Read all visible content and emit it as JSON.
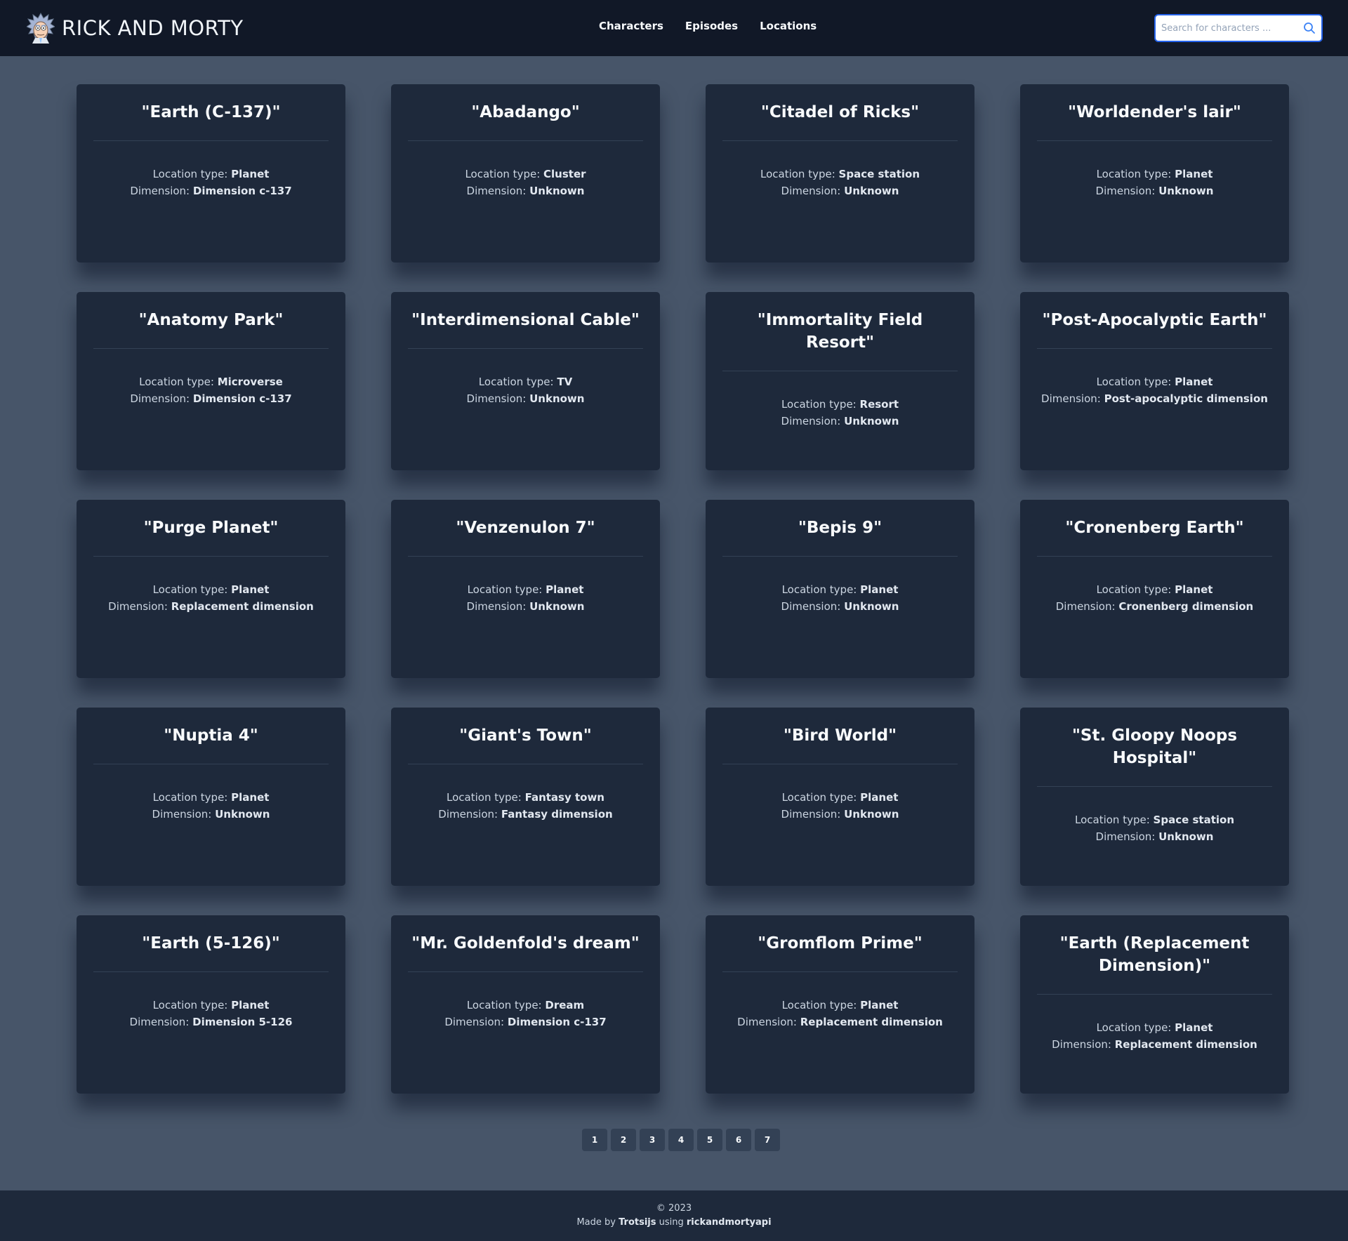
{
  "header": {
    "brand_title": "RICK AND MORTY",
    "nav": [
      "Characters",
      "Episodes",
      "Locations"
    ],
    "search_placeholder": "Search for characters ..."
  },
  "labels": {
    "location_type": "Location type:",
    "dimension": "Dimension:"
  },
  "locations": [
    {
      "name": "\"Earth (C-137)\"",
      "type": "Planet",
      "dimension": "Dimension c-137"
    },
    {
      "name": "\"Abadango\"",
      "type": "Cluster",
      "dimension": "Unknown"
    },
    {
      "name": "\"Citadel of Ricks\"",
      "type": "Space station",
      "dimension": "Unknown"
    },
    {
      "name": "\"Worldender's lair\"",
      "type": "Planet",
      "dimension": "Unknown"
    },
    {
      "name": "\"Anatomy Park\"",
      "type": "Microverse",
      "dimension": "Dimension c-137"
    },
    {
      "name": "\"Interdimensional Cable\"",
      "type": "TV",
      "dimension": "Unknown"
    },
    {
      "name": "\"Immortality Field Resort\"",
      "type": "Resort",
      "dimension": "Unknown"
    },
    {
      "name": "\"Post-Apocalyptic Earth\"",
      "type": "Planet",
      "dimension": "Post-apocalyptic dimension"
    },
    {
      "name": "\"Purge Planet\"",
      "type": "Planet",
      "dimension": "Replacement dimension"
    },
    {
      "name": "\"Venzenulon 7\"",
      "type": "Planet",
      "dimension": "Unknown"
    },
    {
      "name": "\"Bepis 9\"",
      "type": "Planet",
      "dimension": "Unknown"
    },
    {
      "name": "\"Cronenberg Earth\"",
      "type": "Planet",
      "dimension": "Cronenberg dimension"
    },
    {
      "name": "\"Nuptia 4\"",
      "type": "Planet",
      "dimension": "Unknown"
    },
    {
      "name": "\"Giant's Town\"",
      "type": "Fantasy town",
      "dimension": "Fantasy dimension"
    },
    {
      "name": "\"Bird World\"",
      "type": "Planet",
      "dimension": "Unknown"
    },
    {
      "name": "\"St. Gloopy Noops Hospital\"",
      "type": "Space station",
      "dimension": "Unknown"
    },
    {
      "name": "\"Earth (5-126)\"",
      "type": "Planet",
      "dimension": "Dimension 5-126"
    },
    {
      "name": "\"Mr. Goldenfold's dream\"",
      "type": "Dream",
      "dimension": "Dimension c-137"
    },
    {
      "name": "\"Gromflom Prime\"",
      "type": "Planet",
      "dimension": "Replacement dimension"
    },
    {
      "name": "\"Earth (Replacement Dimension)\"",
      "type": "Planet",
      "dimension": "Replacement dimension"
    }
  ],
  "pagination": [
    "1",
    "2",
    "3",
    "4",
    "5",
    "6",
    "7"
  ],
  "footer": {
    "copyright": "© 2023",
    "made_by_prefix": "Made by",
    "author": "Trotsijs",
    "using": "using",
    "api": "rickandmortyapi"
  }
}
